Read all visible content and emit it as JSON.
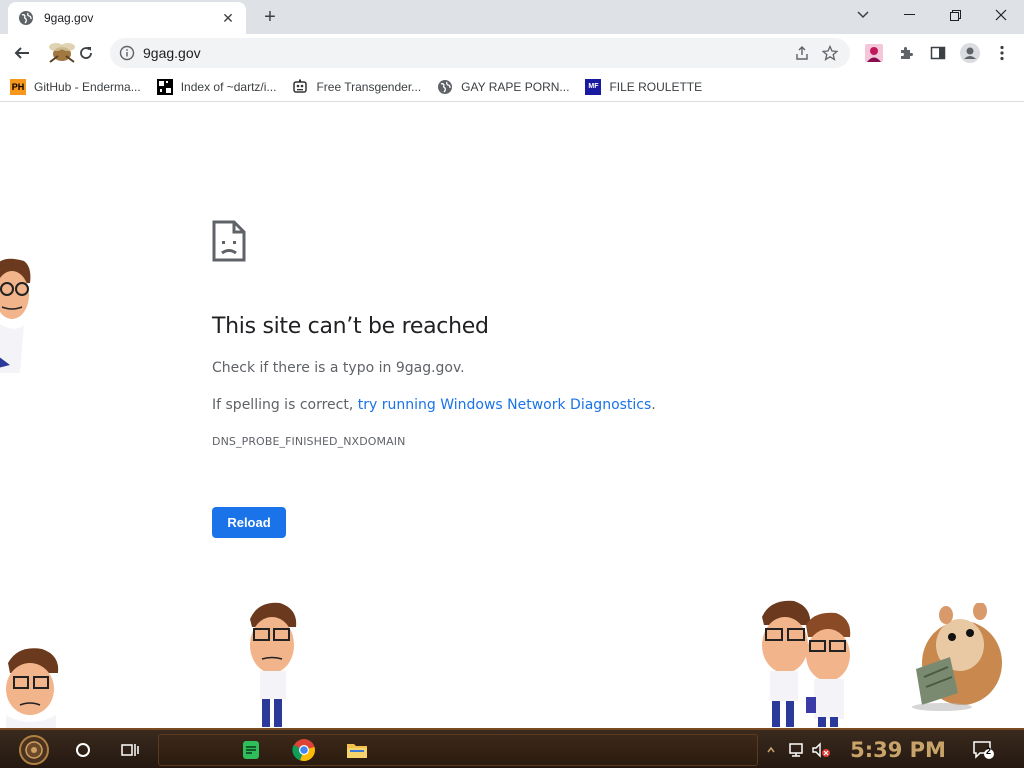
{
  "tab": {
    "title": "9gag.gov",
    "close_glyph": "✕"
  },
  "toolbar": {
    "url": "9gag.gov"
  },
  "window_controls": {
    "tab_search": "⌄",
    "minimize": "—",
    "restore": "❐",
    "close": "✕"
  },
  "bookmarks": [
    {
      "label": "GitHub - Enderma...",
      "icon": "PH",
      "icon_color": "#f7971d"
    },
    {
      "label": "Index of ~dartz/i...",
      "icon": "grid",
      "icon_color": "#000000"
    },
    {
      "label": "Free Transgender...",
      "icon": "robot",
      "icon_color": "#333333"
    },
    {
      "label": "GAY RAPE PORN...",
      "icon": "globe",
      "icon_color": "#5f6368"
    },
    {
      "label": "FILE ROULETTE",
      "icon": "MF",
      "icon_color": "#1a1aa0"
    }
  ],
  "error": {
    "title": "This site can’t be reached",
    "line1": "Check if there is a typo in 9gag.gov.",
    "line2_prefix": "If spelling is correct, ",
    "line2_link": "try running Windows Network Diagnostics",
    "line2_suffix": ".",
    "code": "DNS_PROBE_FINISHED_NXDOMAIN",
    "reload": "Reload"
  },
  "taskbar": {
    "clock": "5:39 PM",
    "notifications": "2"
  },
  "colors": {
    "accent": "#1a73e8",
    "tabstrip": "#dee1e6"
  }
}
